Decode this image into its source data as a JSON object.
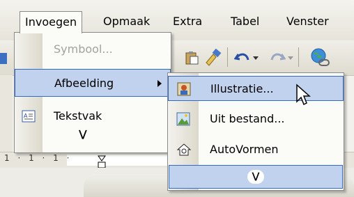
{
  "menubar": {
    "items": [
      {
        "label": "Invoegen",
        "active": true
      },
      {
        "label": "Opmaak"
      },
      {
        "label": "Extra"
      },
      {
        "label": "Tabel"
      },
      {
        "label": "Venster"
      }
    ]
  },
  "dropdown": {
    "items": [
      {
        "label": "Symbool...",
        "disabled": true
      },
      {
        "label": "Afbeelding",
        "has_submenu": true,
        "selected": true
      },
      {
        "label": "Tekstvak"
      }
    ],
    "expand_icon": "double-chevron-down-icon"
  },
  "submenu": {
    "items": [
      {
        "label": "Illustratie...",
        "selected": true,
        "icon": "clipart-icon"
      },
      {
        "label": "Uit bestand...",
        "icon": "picture-file-icon"
      },
      {
        "label": "AutoVormen",
        "icon": "autoshapes-icon"
      }
    ],
    "expand_icon": "double-chevron-down-icon"
  },
  "ruler": {
    "marks": "1 · 1 · 1 ·"
  },
  "colors": {
    "selection_fill": "#c1d2ee",
    "selection_border": "#316ac5",
    "menu_bg": "#fbfbf8"
  }
}
